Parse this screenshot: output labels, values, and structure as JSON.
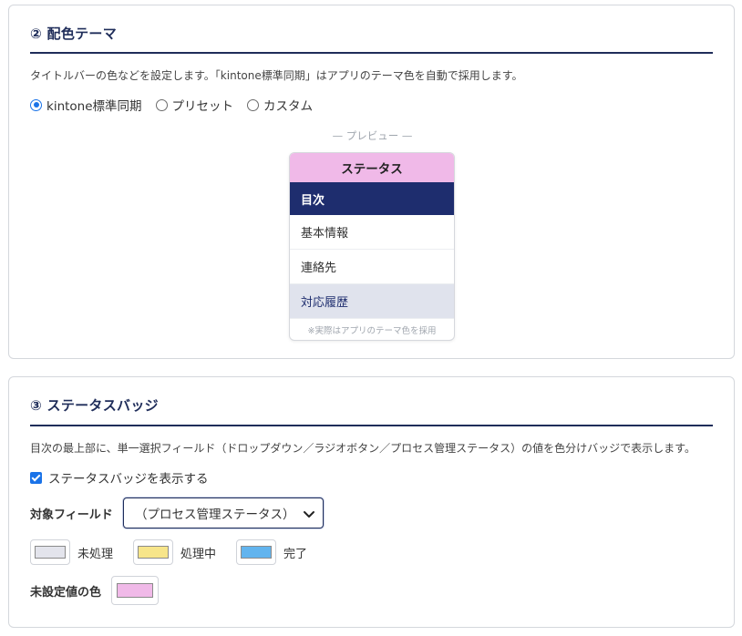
{
  "theme_section": {
    "title": "② 配色テーマ",
    "description": "タイトルバーの色などを設定します。「kintone標準同期」はアプリのテーマ色を自動で採用します。",
    "options": [
      {
        "label": "kintone標準同期",
        "checked": true
      },
      {
        "label": "プリセット",
        "checked": false
      },
      {
        "label": "カスタム",
        "checked": false
      }
    ],
    "preview": {
      "caption": "— プレビュー —",
      "header": "ステータス",
      "items": [
        "目次",
        "基本情報",
        "連絡先",
        "対応履歴"
      ],
      "active_item": "目次",
      "highlighted_item": "対応履歴",
      "note": "※実際はアプリのテーマ色を採用",
      "colors": {
        "header_bg": "#f0b9e8",
        "active_bg": "#1e2d6e",
        "highlight_bg": "#e0e3ed"
      }
    }
  },
  "badge_section": {
    "title": "③ ステータスバッジ",
    "description": "目次の最上部に、単一選択フィールド（ドロップダウン／ラジオボタン／プロセス管理ステータス）の値を色分けバッジで表示します。",
    "show_badge": {
      "label": "ステータスバッジを表示する",
      "checked": true
    },
    "target_field": {
      "label": "対象フィールド",
      "value": "（プロセス管理ステータス）"
    },
    "statuses": [
      {
        "label": "未処理",
        "color": "#e3e4ec"
      },
      {
        "label": "処理中",
        "color": "#f7e58a"
      },
      {
        "label": "完了",
        "color": "#62b4ee"
      }
    ],
    "unset": {
      "label": "未設定値の色",
      "color": "#f0b9e8"
    }
  },
  "accent_color": "#1f2d5a",
  "control_color": "#1a73e8"
}
